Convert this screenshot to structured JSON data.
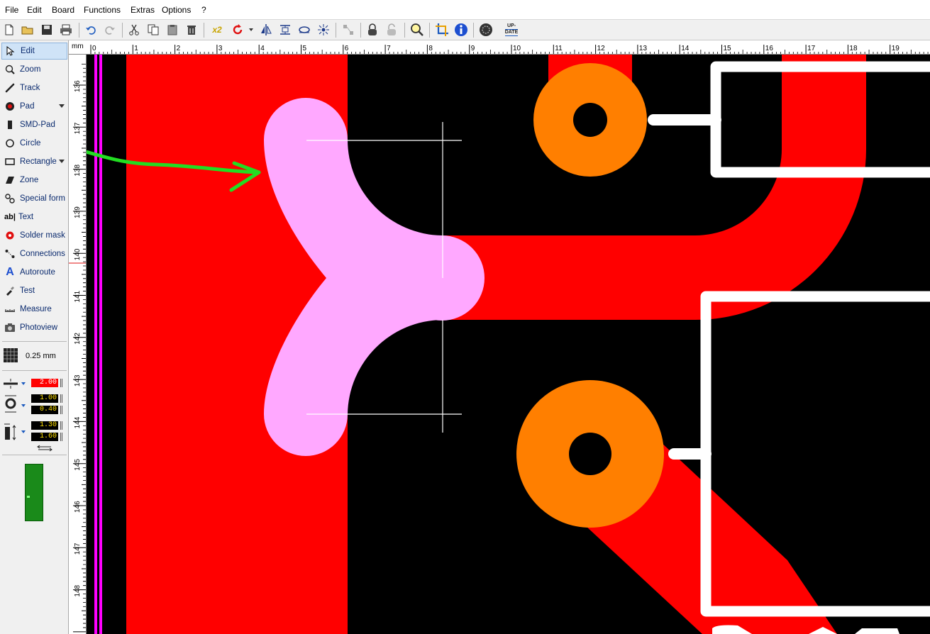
{
  "menu": [
    "File",
    "Edit",
    "Board",
    "Functions",
    "Extras",
    "Options",
    "?"
  ],
  "toolbar": {
    "icons": [
      "new-file-icon",
      "open-folder-icon",
      "save-icon",
      "print-icon",
      "undo-icon",
      "redo-icon",
      "cut-icon",
      "copy-icon",
      "paste-icon",
      "delete-icon",
      "zoom-x2-icon",
      "rotate-icon",
      "mirror-icon",
      "align-icon",
      "flip-icon",
      "scatter-icon",
      "group-icon",
      "lock-icon",
      "unlock-icon",
      "magnifier-icon",
      "crop-icon",
      "info-icon",
      "settings-gear-icon",
      "update-icon"
    ],
    "zoom_label": "x2",
    "update_label_1": "UP-",
    "update_label_2": "DATE"
  },
  "tools": [
    {
      "label": "Edit",
      "icon": "cursor-arrow-icon",
      "selected": true
    },
    {
      "label": "Zoom",
      "icon": "zoom-icon"
    },
    {
      "label": "Track",
      "icon": "track-icon"
    },
    {
      "label": "Pad",
      "icon": "pad-icon",
      "dropdown": true
    },
    {
      "label": "SMD-Pad",
      "icon": "smd-pad-icon"
    },
    {
      "label": "Circle",
      "icon": "circle-icon"
    },
    {
      "label": "Rectangle",
      "icon": "rectangle-icon",
      "dropdown": true
    },
    {
      "label": "Zone",
      "icon": "zone-icon"
    },
    {
      "label": "Special form",
      "icon": "special-form-icon"
    },
    {
      "label": "Text",
      "icon": "text-icon"
    },
    {
      "label": "Solder mask",
      "icon": "solder-mask-icon"
    },
    {
      "label": "Connections",
      "icon": "connections-icon"
    },
    {
      "label": "Autoroute",
      "icon": "autoroute-icon"
    },
    {
      "label": "Test",
      "icon": "test-icon"
    },
    {
      "label": "Measure",
      "icon": "measure-icon"
    },
    {
      "label": "Photoview",
      "icon": "photoview-icon"
    }
  ],
  "grid": {
    "value": "0.25 mm"
  },
  "params": {
    "track_width": "2.00",
    "pad_outer": "1.00",
    "pad_inner": "0.40",
    "smd_width": "1.30",
    "smd_height": "1.60"
  },
  "ruler": {
    "unit": "mm",
    "x_labels": [
      "0",
      "1",
      "2",
      "3",
      "4",
      "5",
      "6",
      "7",
      "8",
      "9",
      "10",
      "11",
      "12",
      "13",
      "14",
      "15",
      "16",
      "17",
      "18",
      "19"
    ],
    "y_labels": [
      "136",
      "137",
      "138",
      "139",
      "140",
      "141",
      "142",
      "143",
      "144",
      "145",
      "146",
      "147",
      "148",
      "9"
    ]
  },
  "colors": {
    "copper_top": "#ff0000",
    "pad": "#ff7f00",
    "special_form": "#ffa8ff",
    "silkscreen": "#ffffff",
    "board_edge": "#ff00ff",
    "annotation_arrow": "#22dd22",
    "background": "#000000",
    "numbox_text": "#ffe000"
  }
}
